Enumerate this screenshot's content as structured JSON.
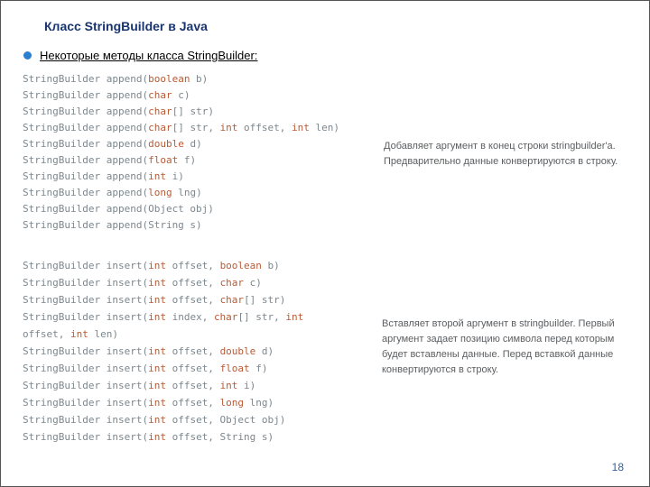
{
  "title": "Класс  StringBuilder в Java",
  "bullet": "Некоторые методы класса StringBuilder:",
  "append_methods": [
    [
      [
        "",
        "StringBuilder append("
      ],
      [
        "kw",
        "boolean"
      ],
      [
        "",
        " b)"
      ]
    ],
    [
      [
        "",
        "StringBuilder append("
      ],
      [
        "kw",
        "char"
      ],
      [
        "",
        " c)"
      ]
    ],
    [
      [
        "",
        "StringBuilder append("
      ],
      [
        "kw",
        "char"
      ],
      [
        "",
        "[] str)"
      ]
    ],
    [
      [
        "",
        "StringBuilder append("
      ],
      [
        "kw",
        "char"
      ],
      [
        "",
        "[] str, "
      ],
      [
        "kw",
        "int"
      ],
      [
        "",
        " offset, "
      ],
      [
        "kw",
        "int"
      ],
      [
        "",
        " len)"
      ]
    ],
    [
      [
        "",
        "StringBuilder append("
      ],
      [
        "kw",
        "double"
      ],
      [
        "",
        " d)"
      ]
    ],
    [
      [
        "",
        "StringBuilder append("
      ],
      [
        "kw",
        "float"
      ],
      [
        "",
        " f)"
      ]
    ],
    [
      [
        "",
        "StringBuilder append("
      ],
      [
        "kw",
        "int"
      ],
      [
        "",
        " i)"
      ]
    ],
    [
      [
        "",
        "StringBuilder append("
      ],
      [
        "kw",
        "long"
      ],
      [
        "",
        " lng)"
      ]
    ],
    [
      [
        "",
        "StringBuilder append(Object obj)"
      ]
    ],
    [
      [
        "",
        "StringBuilder append(String s)"
      ]
    ]
  ],
  "append_desc": "Добавляет аргумент в конец строки stringbuilder'а. Предварительно данные конвертируются в строку.",
  "insert_methods": [
    [
      [
        "",
        "StringBuilder insert("
      ],
      [
        "kw",
        "int"
      ],
      [
        "",
        " offset, "
      ],
      [
        "kw",
        "boolean"
      ],
      [
        "",
        " b)"
      ]
    ],
    [
      [
        "",
        "StringBuilder insert("
      ],
      [
        "kw",
        "int"
      ],
      [
        "",
        " offset, "
      ],
      [
        "kw",
        "char"
      ],
      [
        "",
        " c)"
      ]
    ],
    [
      [
        "",
        "StringBuilder insert("
      ],
      [
        "kw",
        "int"
      ],
      [
        "",
        " offset, "
      ],
      [
        "kw",
        "char"
      ],
      [
        "",
        "[] str)"
      ]
    ],
    [
      [
        "",
        "StringBuilder insert("
      ],
      [
        "kw",
        "int"
      ],
      [
        "",
        " index, "
      ],
      [
        "kw",
        "char"
      ],
      [
        "",
        "[] str, "
      ],
      [
        "kw",
        "int"
      ],
      [
        "",
        " "
      ]
    ],
    [
      [
        "",
        "offset, "
      ],
      [
        "kw",
        "int"
      ],
      [
        "",
        " len)"
      ]
    ],
    [
      [
        "",
        "StringBuilder insert("
      ],
      [
        "kw",
        "int"
      ],
      [
        "",
        " offset, "
      ],
      [
        "kw",
        "double"
      ],
      [
        "",
        " d)"
      ]
    ],
    [
      [
        "",
        "StringBuilder insert("
      ],
      [
        "kw",
        "int"
      ],
      [
        "",
        " offset, "
      ],
      [
        "kw",
        "float"
      ],
      [
        "",
        " f)"
      ]
    ],
    [
      [
        "",
        "StringBuilder insert("
      ],
      [
        "kw",
        "int"
      ],
      [
        "",
        " offset, "
      ],
      [
        "kw",
        "int"
      ],
      [
        "",
        " i)"
      ]
    ],
    [
      [
        "",
        "StringBuilder insert("
      ],
      [
        "kw",
        "int"
      ],
      [
        "",
        " offset, "
      ],
      [
        "kw",
        "long"
      ],
      [
        "",
        " lng)"
      ]
    ],
    [
      [
        "",
        "StringBuilder insert("
      ],
      [
        "kw",
        "int"
      ],
      [
        "",
        " offset, Object obj)"
      ]
    ],
    [
      [
        "",
        "StringBuilder insert("
      ],
      [
        "kw",
        "int"
      ],
      [
        "",
        " offset, String s)"
      ]
    ]
  ],
  "insert_desc": "Вставляет второй аргумент в stringbuilder. Первый аргумент задает позицию символа перед которым будет вставлены данные. Перед вставкой данные конвертируются в строку.",
  "page": "18"
}
